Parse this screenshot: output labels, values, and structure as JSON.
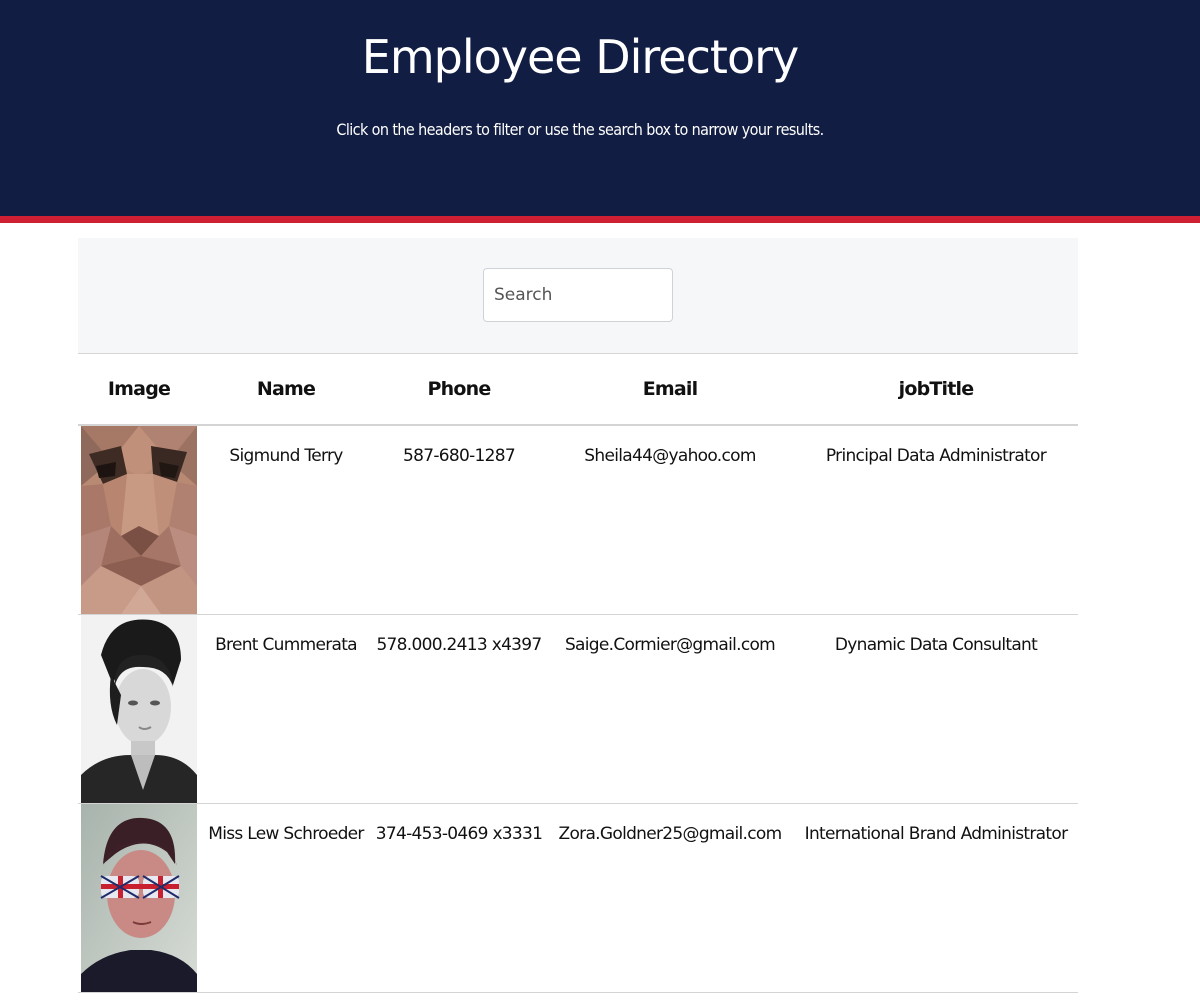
{
  "header": {
    "title": "Employee Directory",
    "subtitle": "Click on the headers to filter or use the search box to narrow your results."
  },
  "search": {
    "placeholder": "Search",
    "value": ""
  },
  "table": {
    "columns": [
      "Image",
      "Name",
      "Phone",
      "Email",
      "jobTitle"
    ],
    "rows": [
      {
        "name": "Sigmund Terry",
        "phone": "587-680-1287",
        "email": "Sheila44@yahoo.com",
        "jobTitle": "Principal Data Administrator",
        "image": "low-poly-face-portrait"
      },
      {
        "name": "Brent Cummerata",
        "phone": "578.000.2413 x4397",
        "email": "Saige.Cormier@gmail.com",
        "jobTitle": "Dynamic Data Consultant",
        "image": "black-and-white-man-portrait"
      },
      {
        "name": "Miss Lew Schroeder",
        "phone": "374-453-0469 x3331",
        "email": "Zora.Goldner25@gmail.com",
        "jobTitle": "International Brand Administrator",
        "image": "man-with-flag-sunglasses-portrait"
      }
    ]
  },
  "colors": {
    "header_bg": "#111d42",
    "header_accent": "#cf2033",
    "panel_bg": "#f6f7f8"
  }
}
